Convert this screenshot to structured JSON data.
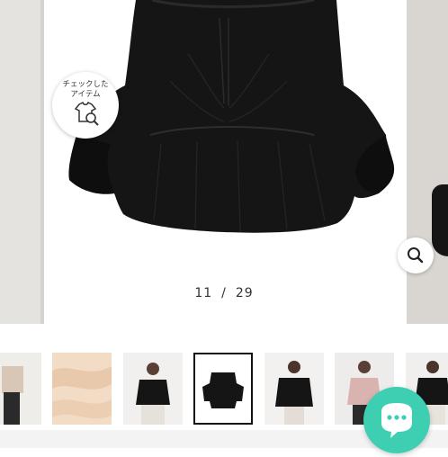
{
  "product_gallery": {
    "checked_items_chip": {
      "label_line1": "チェックした",
      "label_line2": "アイテム",
      "icon": "shirt-search-icon"
    },
    "zoom_icon": "magnifier-icon",
    "counter": {
      "current": "11",
      "separator": "/",
      "total": "29"
    },
    "thumbnails": [
      {
        "name": "thumbnail-model-front-beige",
        "active": false
      },
      {
        "name": "thumbnail-fabric-closeup",
        "active": false
      },
      {
        "name": "thumbnail-model-black-top",
        "active": false
      },
      {
        "name": "thumbnail-black-blouse-flat",
        "active": true
      },
      {
        "name": "thumbnail-model-black-pose",
        "active": false
      },
      {
        "name": "thumbnail-model-pink-top",
        "active": false
      },
      {
        "name": "thumbnail-model-black-casual",
        "active": false
      }
    ]
  },
  "chat": {
    "icon": "chat-bubble-icon"
  },
  "colors": {
    "accent_chat": "#3ecfb3",
    "garment": "#151515",
    "thumb_active_border": "#111111"
  }
}
